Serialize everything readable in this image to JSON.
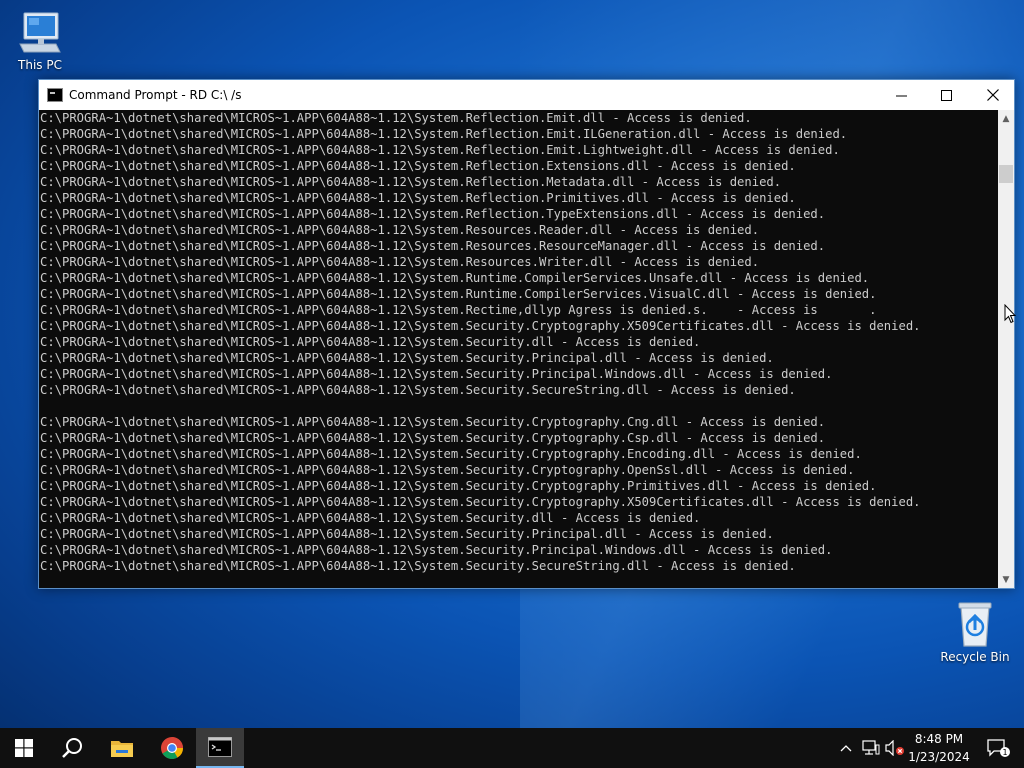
{
  "desktop": {
    "icons": [
      {
        "label": "This PC",
        "icon": "computer-icon"
      },
      {
        "label": "Recycle Bin",
        "icon": "recycle-bin-icon"
      }
    ]
  },
  "window": {
    "title": "Command Prompt - RD  C:\\ /s",
    "buttons": {
      "minimize": "minimize-icon",
      "maximize": "maximize-icon",
      "close": "close-icon"
    }
  },
  "console": {
    "lines": [
      "C:\\PROGRA~1\\dotnet\\shared\\MICROS~1.APP\\604A88~1.12\\System.Reflection.Emit.dll - Access is denied.",
      "C:\\PROGRA~1\\dotnet\\shared\\MICROS~1.APP\\604A88~1.12\\System.Reflection.Emit.ILGeneration.dll - Access is denied.",
      "C:\\PROGRA~1\\dotnet\\shared\\MICROS~1.APP\\604A88~1.12\\System.Reflection.Emit.Lightweight.dll - Access is denied.",
      "C:\\PROGRA~1\\dotnet\\shared\\MICROS~1.APP\\604A88~1.12\\System.Reflection.Extensions.dll - Access is denied.",
      "C:\\PROGRA~1\\dotnet\\shared\\MICROS~1.APP\\604A88~1.12\\System.Reflection.Metadata.dll - Access is denied.",
      "C:\\PROGRA~1\\dotnet\\shared\\MICROS~1.APP\\604A88~1.12\\System.Reflection.Primitives.dll - Access is denied.",
      "C:\\PROGRA~1\\dotnet\\shared\\MICROS~1.APP\\604A88~1.12\\System.Reflection.TypeExtensions.dll - Access is denied.",
      "C:\\PROGRA~1\\dotnet\\shared\\MICROS~1.APP\\604A88~1.12\\System.Resources.Reader.dll - Access is denied.",
      "C:\\PROGRA~1\\dotnet\\shared\\MICROS~1.APP\\604A88~1.12\\System.Resources.ResourceManager.dll - Access is denied.",
      "C:\\PROGRA~1\\dotnet\\shared\\MICROS~1.APP\\604A88~1.12\\System.Resources.Writer.dll - Access is denied.",
      "C:\\PROGRA~1\\dotnet\\shared\\MICROS~1.APP\\604A88~1.12\\System.Runtime.CompilerServices.Unsafe.dll - Access is denied.",
      "C:\\PROGRA~1\\dotnet\\shared\\MICROS~1.APP\\604A88~1.12\\System.Runtime.CompilerServices.VisualC.dll - Access is denied.",
      "C:\\PROGRA~1\\dotnet\\shared\\MICROS~1.APP\\604A88~1.12\\System.Rectime,dllyp Agress is denied.s.    - Access is       .",
      "C:\\PROGRA~1\\dotnet\\shared\\MICROS~1.APP\\604A88~1.12\\System.Security.Cryptography.X509Certificates.dll - Access is denied.",
      "C:\\PROGRA~1\\dotnet\\shared\\MICROS~1.APP\\604A88~1.12\\System.Security.dll - Access is denied.",
      "C:\\PROGRA~1\\dotnet\\shared\\MICROS~1.APP\\604A88~1.12\\System.Security.Principal.dll - Access is denied.",
      "C:\\PROGRA~1\\dotnet\\shared\\MICROS~1.APP\\604A88~1.12\\System.Security.Principal.Windows.dll - Access is denied.",
      "C:\\PROGRA~1\\dotnet\\shared\\MICROS~1.APP\\604A88~1.12\\System.Security.SecureString.dll - Access is denied.",
      "",
      "C:\\PROGRA~1\\dotnet\\shared\\MICROS~1.APP\\604A88~1.12\\System.Security.Cryptography.Cng.dll - Access is denied.",
      "C:\\PROGRA~1\\dotnet\\shared\\MICROS~1.APP\\604A88~1.12\\System.Security.Cryptography.Csp.dll - Access is denied.",
      "C:\\PROGRA~1\\dotnet\\shared\\MICROS~1.APP\\604A88~1.12\\System.Security.Cryptography.Encoding.dll - Access is denied.",
      "C:\\PROGRA~1\\dotnet\\shared\\MICROS~1.APP\\604A88~1.12\\System.Security.Cryptography.OpenSsl.dll - Access is denied.",
      "C:\\PROGRA~1\\dotnet\\shared\\MICROS~1.APP\\604A88~1.12\\System.Security.Cryptography.Primitives.dll - Access is denied.",
      "C:\\PROGRA~1\\dotnet\\shared\\MICROS~1.APP\\604A88~1.12\\System.Security.Cryptography.X509Certificates.dll - Access is denied.",
      "C:\\PROGRA~1\\dotnet\\shared\\MICROS~1.APP\\604A88~1.12\\System.Security.dll - Access is denied.",
      "C:\\PROGRA~1\\dotnet\\shared\\MICROS~1.APP\\604A88~1.12\\System.Security.Principal.dll - Access is denied.",
      "C:\\PROGRA~1\\dotnet\\shared\\MICROS~1.APP\\604A88~1.12\\System.Security.Principal.Windows.dll - Access is denied.",
      "C:\\PROGRA~1\\dotnet\\shared\\MICROS~1.APP\\604A88~1.12\\System.Security.SecureString.dll - Access is denied."
    ],
    "text_color": "#cccccc",
    "background": "#0c0c0c"
  },
  "taskbar": {
    "buttons": [
      {
        "icon": "windows-start-icon"
      },
      {
        "icon": "search-icon"
      },
      {
        "icon": "file-explorer-icon"
      },
      {
        "icon": "chrome-icon"
      },
      {
        "icon": "command-prompt-icon",
        "active": true
      }
    ],
    "tray": {
      "icons": [
        "chevron-up-icon",
        "network-icon",
        "volume-muted-icon"
      ],
      "time": "8:48 PM",
      "date": "1/23/2024",
      "notification_count": "1"
    }
  },
  "colors": {
    "accent": "#77b7f0",
    "taskbar": "#101010",
    "desktop": "#0b54b4"
  }
}
